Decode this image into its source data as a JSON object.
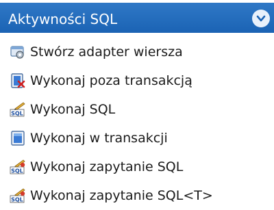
{
  "header": {
    "title": "Aktywności SQL",
    "collapse_icon": "chevron-down-icon"
  },
  "items": [
    {
      "label": "Stwórz adapter wiersza",
      "icon": "row-adapter-icon"
    },
    {
      "label": "Wykonaj poza transakcją",
      "icon": "execute-outside-transaction-icon"
    },
    {
      "label": "Wykonaj SQL",
      "icon": "sql-icon"
    },
    {
      "label": "Wykonaj w transakcji",
      "icon": "transaction-icon"
    },
    {
      "label": "Wykonaj zapytanie SQL",
      "icon": "sql-query-icon"
    },
    {
      "label": "Wykonaj zapytanie SQL<T>",
      "icon": "sql-query-generic-icon"
    }
  ],
  "colors": {
    "header_bg": "#1f68b9",
    "header_text": "#ffffff",
    "item_text": "#1a1a1a"
  }
}
